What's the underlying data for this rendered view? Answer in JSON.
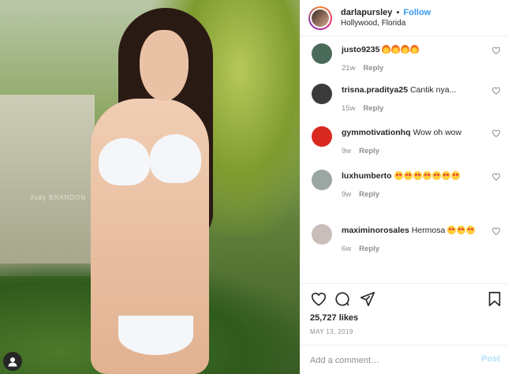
{
  "post": {
    "photo_watermark": "Judy BRANDON",
    "image_alt": "Woman in white bikini posing in front of palm trees"
  },
  "header": {
    "username": "darlapursley",
    "separator": "•",
    "follow_label": "Follow",
    "location": "Hollywood, Florida"
  },
  "comments": [
    {
      "user": "justo9235",
      "text": "",
      "emoji_count": 4,
      "emoji": "fire",
      "age": "21w",
      "reply_label": "Reply",
      "avatar_color": "#4a6b5a"
    },
    {
      "user": "trisna.praditya25",
      "text": "Cantik nya...",
      "emoji_count": 0,
      "emoji": "",
      "age": "15w",
      "reply_label": "Reply",
      "avatar_color": "#3b3b3b"
    },
    {
      "user": "gymmotivationhq",
      "text": "Wow oh wow",
      "emoji_count": 0,
      "emoji": "",
      "age": "9w",
      "reply_label": "Reply",
      "avatar_color": "#d9281f"
    },
    {
      "user": "luxhumberto",
      "text": "",
      "emoji_count": 7,
      "emoji": "starstruck",
      "age": "9w",
      "reply_label": "Reply",
      "avatar_color": "#9aa7a2"
    },
    {
      "user": "maximinorosales",
      "text": "Hermosa",
      "emoji_count": 3,
      "emoji": "starstruck",
      "age": "6w",
      "reply_label": "Reply",
      "avatar_color": "#c9beba"
    }
  ],
  "actions": {
    "likes": "25,727 likes",
    "date": "MAY 13, 2019"
  },
  "add_comment": {
    "placeholder": "Add a comment…",
    "post_label": "Post"
  },
  "icons": [
    "heart-icon",
    "comment-icon",
    "share-icon",
    "bookmark-icon",
    "profile-icon"
  ],
  "colors": {
    "link": "#3897f0",
    "post_disabled": "#b2dffc",
    "meta": "#8e8e8e"
  }
}
